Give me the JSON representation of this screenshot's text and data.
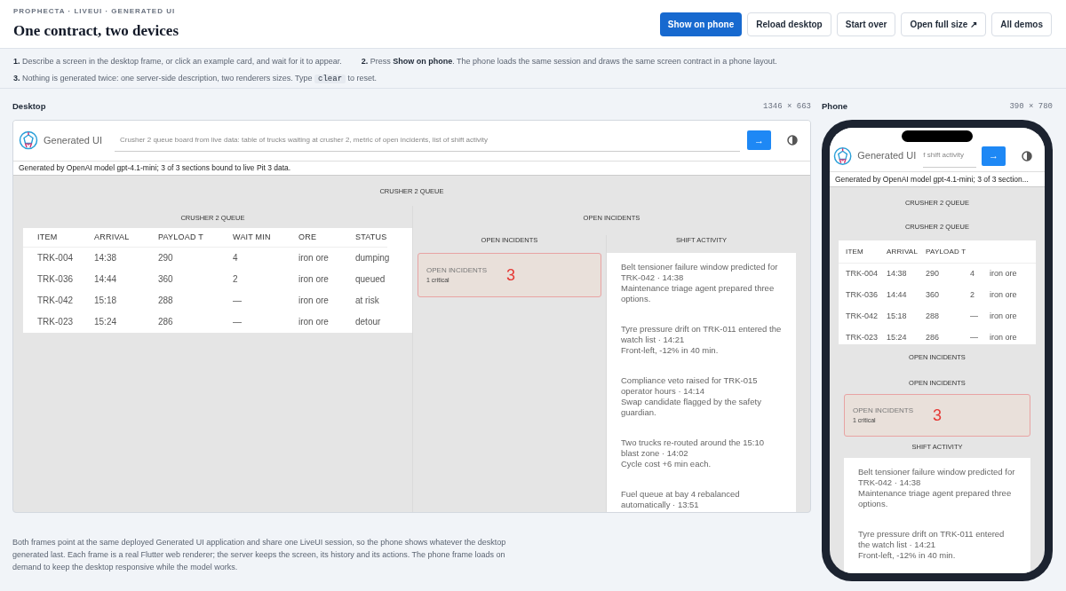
{
  "header": {
    "eyebrow": "PROPHECTA · LIVEUI · GENERATED UI",
    "title": "One contract, two devices",
    "buttons": [
      {
        "label": "Show on phone",
        "primary": true
      },
      {
        "label": "Reload desktop",
        "primary": false
      },
      {
        "label": "Start over",
        "primary": false
      },
      {
        "label": "Open full size ↗",
        "primary": false
      },
      {
        "label": "All demos",
        "primary": false
      }
    ]
  },
  "steps": [
    {
      "number": "1.",
      "text": "Describe a screen in the desktop frame, or click an example card, and wait for it to appear."
    },
    {
      "number": "2.",
      "text": "Press **Show on phone**. The phone loads the same session and draws the same screen contract in a phone layout."
    },
    {
      "number": "3.",
      "text": "Nothing is generated twice: one server-side description, two renderers sizes. Type",
      "code": "clear",
      "text_after": "to reset."
    }
  ],
  "desktop": {
    "label": "Desktop",
    "size": "1346 × 663",
    "app": {
      "title": "Generated UI",
      "prompt": "Crusher 2 queue board from live data: table of trucks waiting at crusher 2, metric of open incidents, list of shift activity",
      "send": "→",
      "status": "Generated by OpenAI model gpt-4.1-mini; 3 of 3 sections bound to live Pit 3 data.",
      "section_title": "CRUSHER 2 QUEUE",
      "table": {
        "title": "CRUSHER 2 QUEUE",
        "columns": [
          "ITEM",
          "ARRIVAL",
          "PAYLOAD T",
          "WAIT MIN",
          "ORE",
          "STATUS"
        ],
        "rows": [
          [
            "TRK-004",
            "14:38",
            "290",
            "4",
            "iron ore",
            "dumping"
          ],
          [
            "TRK-036",
            "14:44",
            "360",
            "2",
            "iron ore",
            "queued"
          ],
          [
            "TRK-042",
            "15:18",
            "288",
            "—",
            "iron ore",
            "at risk"
          ],
          [
            "TRK-023",
            "15:24",
            "286",
            "—",
            "iron ore",
            "detour"
          ]
        ]
      },
      "incidents_title": "OPEN INCIDENTS",
      "metric_title": "OPEN INCIDENTS",
      "metric": {
        "label": "OPEN INCIDENTS",
        "sub": "1 critical",
        "value": "3"
      },
      "activity_title": "SHIFT ACTIVITY",
      "activity": [
        {
          "title": "Belt tensioner failure window predicted for TRK-042 · 14:38",
          "detail": "Maintenance triage agent prepared three options."
        },
        {
          "title": "Tyre pressure drift on TRK-011 entered the watch list · 14:21",
          "detail": "Front-left, -12% in 40 min."
        },
        {
          "title": "Compliance veto raised for TRK-015 operator hours · 14:14",
          "detail": "Swap candidate flagged by the safety guardian."
        },
        {
          "title": "Two trucks re-routed around the 15:10 blast zone · 14:02",
          "detail": "Cycle cost +6 min each."
        },
        {
          "title": "Fuel queue at bay 4 rebalanced automatically · 13:51"
        }
      ]
    }
  },
  "phone": {
    "label": "Phone",
    "size": "390 × 780",
    "app": {
      "title": "Generated UI",
      "prompt": "f shift activity",
      "send": "→",
      "status": "Generated by OpenAI model gpt-4.1-mini; 3 of 3 section...",
      "section_title": "CRUSHER 2 QUEUE",
      "table": {
        "title": "CRUSHER 2 QUEUE",
        "columns": [
          "ITEM",
          "ARRIVAL",
          "PAYLOAD T"
        ],
        "rows": [
          [
            "TRK-004",
            "14:38",
            "290",
            "4",
            "iron ore"
          ],
          [
            "TRK-036",
            "14:44",
            "360",
            "2",
            "iron ore"
          ],
          [
            "TRK-042",
            "15:18",
            "288",
            "—",
            "iron ore"
          ],
          [
            "TRK-023",
            "15:24",
            "286",
            "—",
            "iron ore"
          ]
        ]
      },
      "incidents_title": "OPEN INCIDENTS",
      "metric_title": "OPEN INCIDENTS",
      "metric": {
        "label": "OPEN INCIDENTS",
        "sub": "1 critical",
        "value": "3"
      },
      "activity_title": "SHIFT ACTIVITY",
      "activity": [
        {
          "title": "Belt tensioner failure window predicted for TRK-042 · 14:38",
          "detail": "Maintenance triage agent prepared three options."
        },
        {
          "title": "Tyre pressure drift on TRK-011 entered the watch list · 14:21",
          "detail": "Front-left, -12% in 40 min."
        }
      ]
    }
  },
  "footer": "Both frames point at the same deployed Generated UI application and share one LiveUI session, so the phone shows whatever the desktop generated last. Each frame is a real Flutter web renderer; the server keeps the screen, its history and its actions. The phone frame loads on demand to keep the desktop responsive while the model works."
}
